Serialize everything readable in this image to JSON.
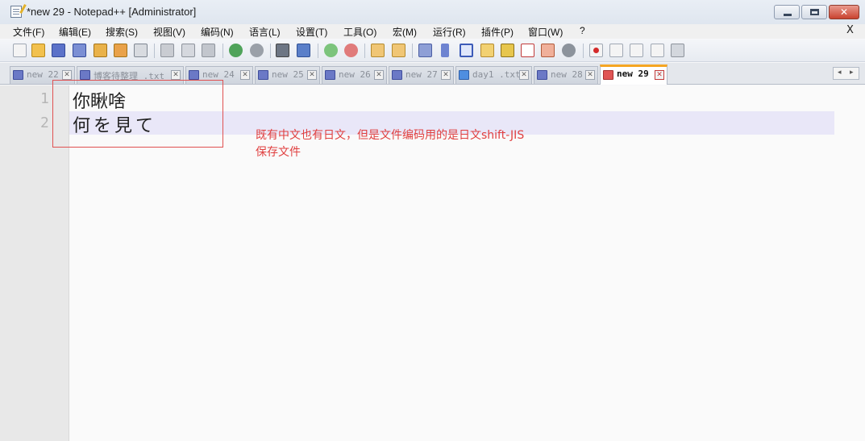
{
  "window": {
    "title": "*new 29 - Notepad++ [Administrator]",
    "min_glyph": "",
    "max_glyph": "",
    "close_glyph": "✕"
  },
  "menu": {
    "items": [
      "文件(F)",
      "编辑(E)",
      "搜索(S)",
      "视图(V)",
      "编码(N)",
      "语言(L)",
      "设置(T)",
      "工具(O)",
      "宏(M)",
      "运行(R)",
      "插件(P)",
      "窗口(W)",
      "?"
    ],
    "close_label": "X"
  },
  "tabs": [
    {
      "label": "new 22",
      "icon": "saved-file-icon"
    },
    {
      "label": "博客待整理 .txt",
      "icon": "saved-file-icon"
    },
    {
      "label": "new 24",
      "icon": "saved-file-icon"
    },
    {
      "label": "new 25",
      "icon": "saved-file-icon"
    },
    {
      "label": "new 26",
      "icon": "saved-file-icon"
    },
    {
      "label": "new 27",
      "icon": "saved-file-icon"
    },
    {
      "label": "day1 .txt",
      "icon": "saved-file-icon"
    },
    {
      "label": "new 28",
      "icon": "saved-file-icon"
    },
    {
      "label": "new 29",
      "icon": "unsaved-file-icon",
      "active": true
    }
  ],
  "tab_close_glyph": "✕",
  "tab_scroll": {
    "left": "◂",
    "right": "▸"
  },
  "editor": {
    "line_numbers": [
      "1",
      "2"
    ],
    "lines": [
      "你瞅啥",
      "何を見て"
    ]
  },
  "annotation": {
    "line1": "既有中文也有日文，但是文件编码用的是日文shift-JIS",
    "line2": "保存文件",
    "color": "#e04040"
  },
  "colors": {
    "active_tab_accent": "#f5a623",
    "current_line_highlight": "#e9e7f8",
    "annotation_box": "#e05151"
  }
}
